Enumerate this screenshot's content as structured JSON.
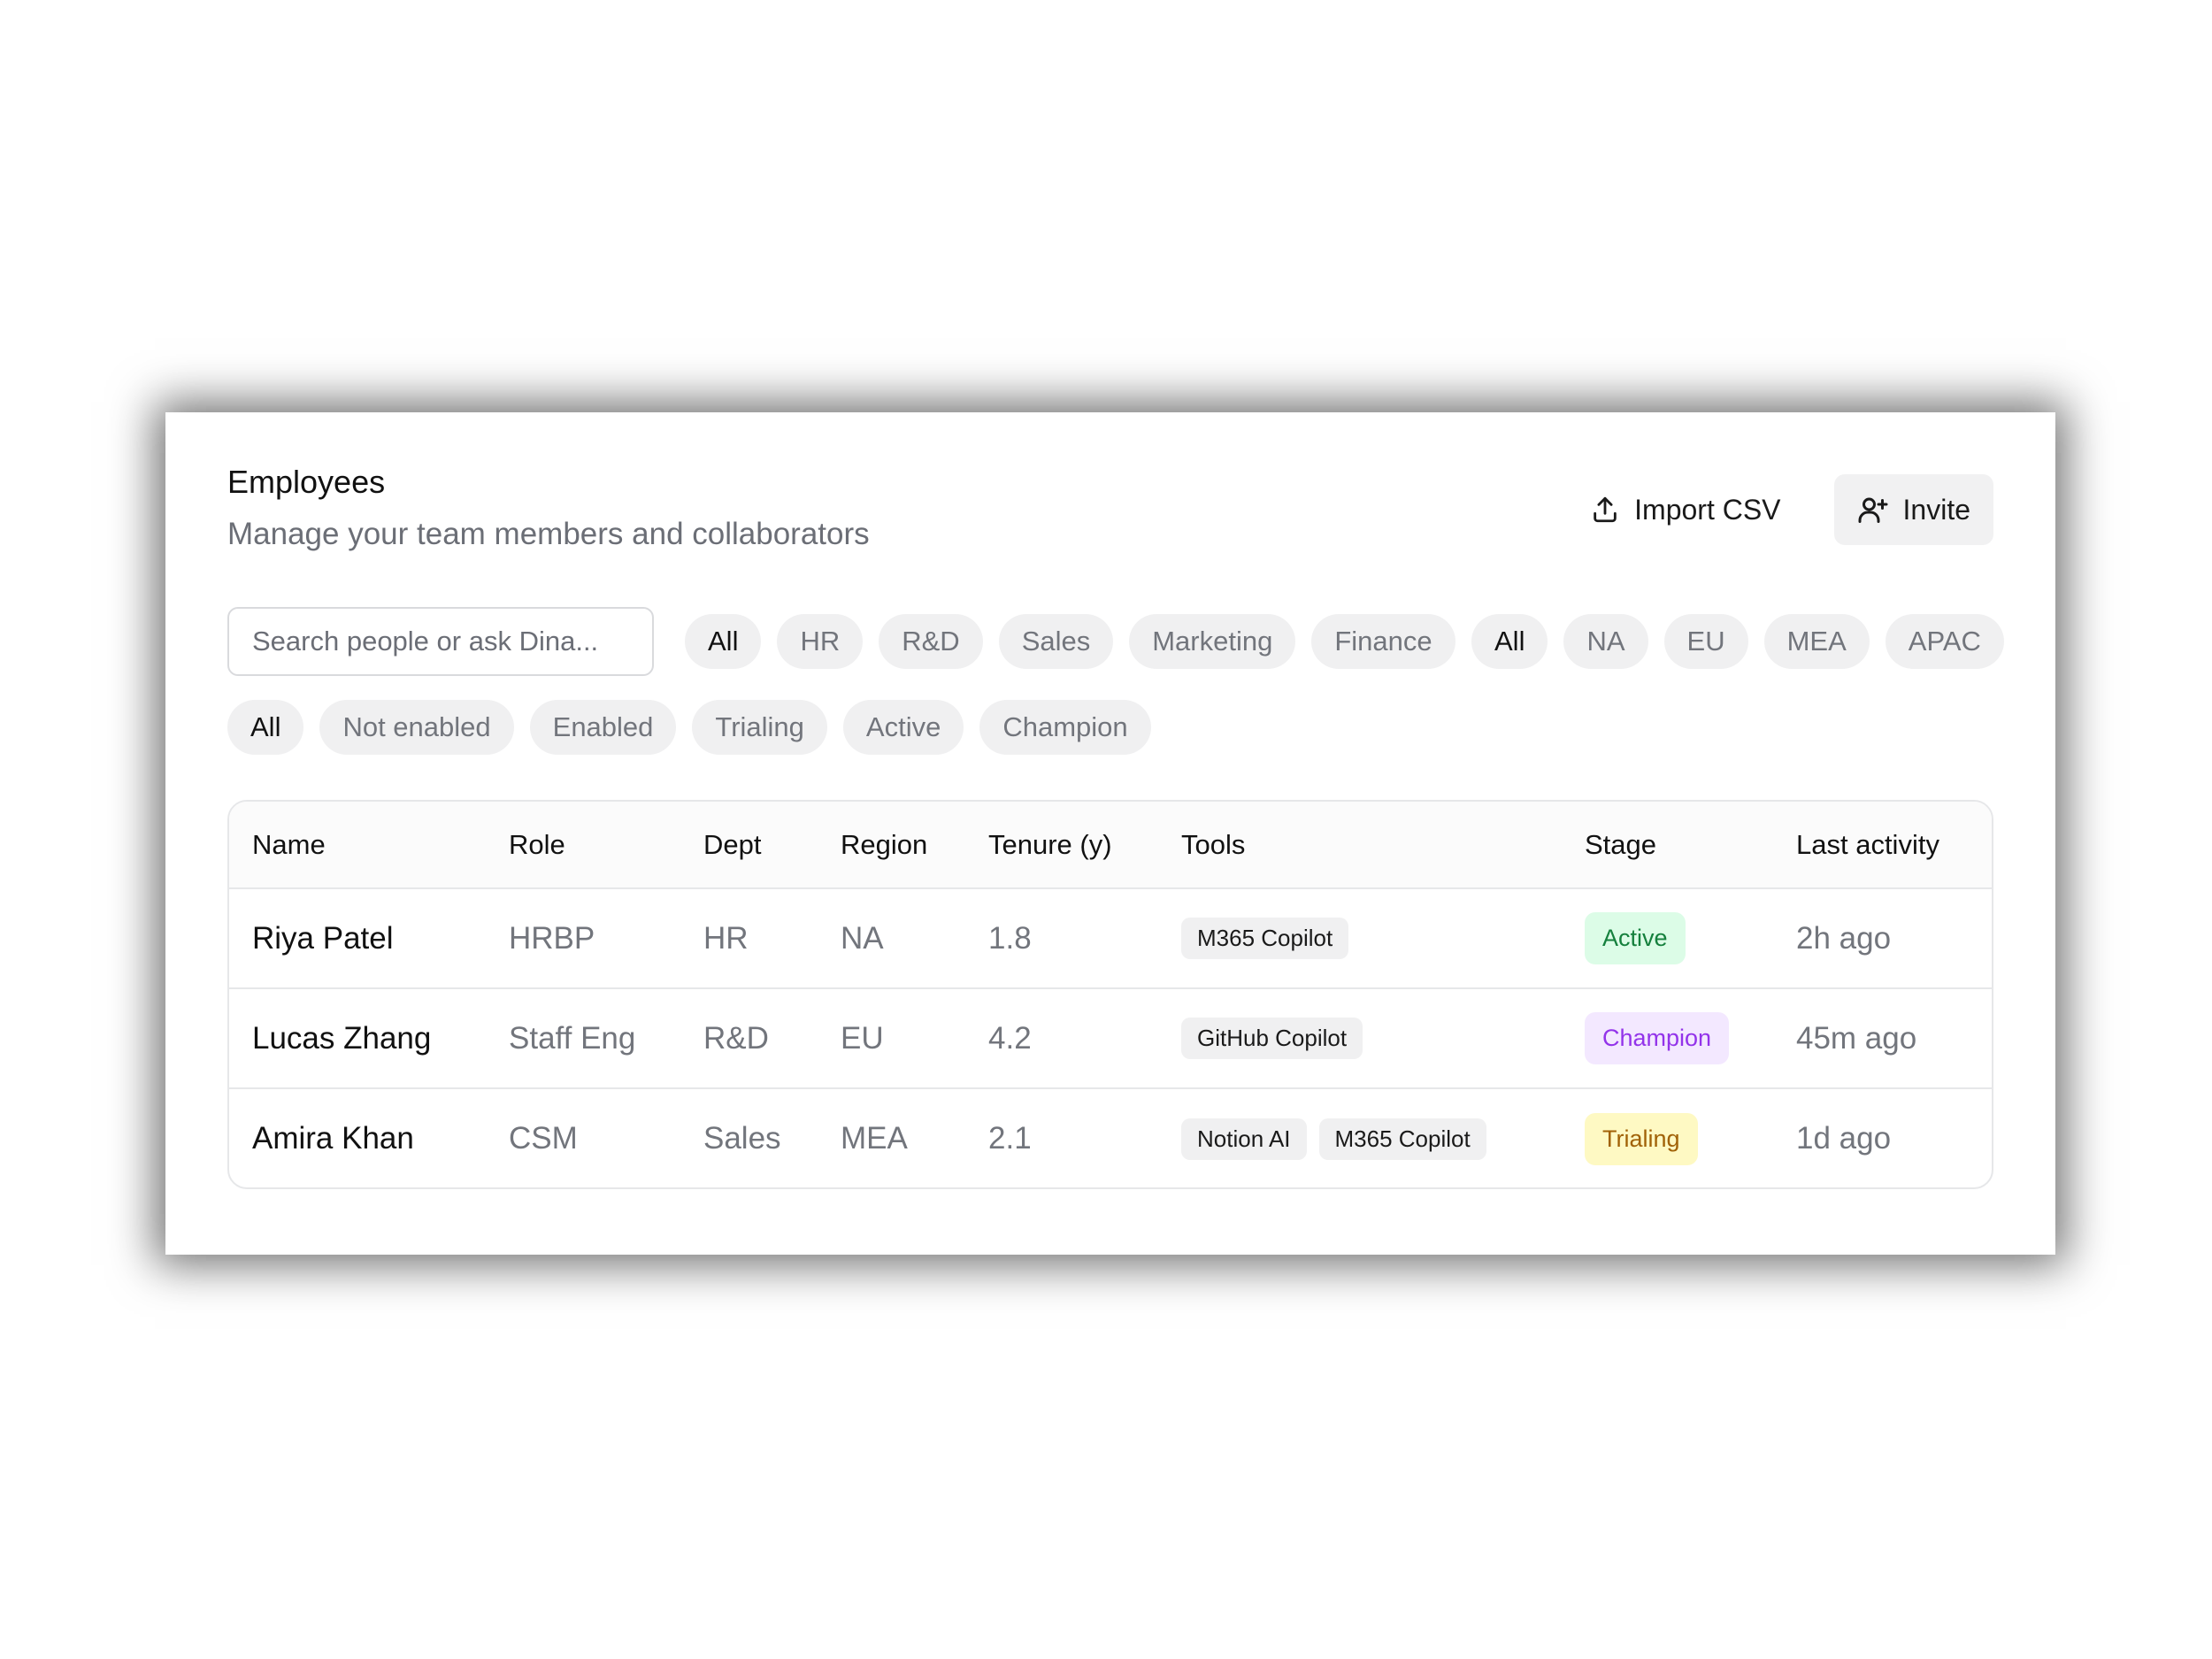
{
  "page": {
    "title": "Employees",
    "subtitle": "Manage your team members and collaborators"
  },
  "actions": {
    "import_label": "Import CSV",
    "import_icon": "upload-icon",
    "invite_label": "Invite",
    "invite_icon": "user-plus-icon"
  },
  "search": {
    "placeholder": "Search people or ask Dina...",
    "value": ""
  },
  "filters": {
    "dept": [
      "All",
      "HR",
      "R&D",
      "Sales",
      "Marketing",
      "Finance"
    ],
    "dept_selected": "All",
    "region": [
      "All",
      "NA",
      "EU",
      "MEA",
      "APAC"
    ],
    "region_selected": "All",
    "stage": [
      "All",
      "Not enabled",
      "Enabled",
      "Trialing",
      "Active",
      "Champion"
    ],
    "stage_selected": "All"
  },
  "table": {
    "columns": [
      "Name",
      "Role",
      "Dept",
      "Region",
      "Tenure (y)",
      "Tools",
      "Stage",
      "Last activity"
    ],
    "rows": [
      {
        "name": "Riya Patel",
        "role": "HRBP",
        "dept": "HR",
        "region": "NA",
        "tenure": "1.8",
        "tools": [
          "M365 Copilot"
        ],
        "stage": "Active",
        "last_activity": "2h ago"
      },
      {
        "name": "Lucas Zhang",
        "role": "Staff Eng",
        "dept": "R&D",
        "region": "EU",
        "tenure": "4.2",
        "tools": [
          "GitHub Copilot"
        ],
        "stage": "Champion",
        "last_activity": "45m ago"
      },
      {
        "name": "Amira Khan",
        "role": "CSM",
        "dept": "Sales",
        "region": "MEA",
        "tenure": "2.1",
        "tools": [
          "Notion AI",
          "M365 Copilot"
        ],
        "stage": "Trialing",
        "last_activity": "1d ago"
      }
    ]
  },
  "stage_colors": {
    "Active": {
      "bg": "#dcfce7",
      "fg": "#15803d"
    },
    "Champion": {
      "bg": "#f3e8ff",
      "fg": "#9333ea"
    },
    "Trialing": {
      "bg": "#fef9c3",
      "fg": "#a16207"
    }
  }
}
